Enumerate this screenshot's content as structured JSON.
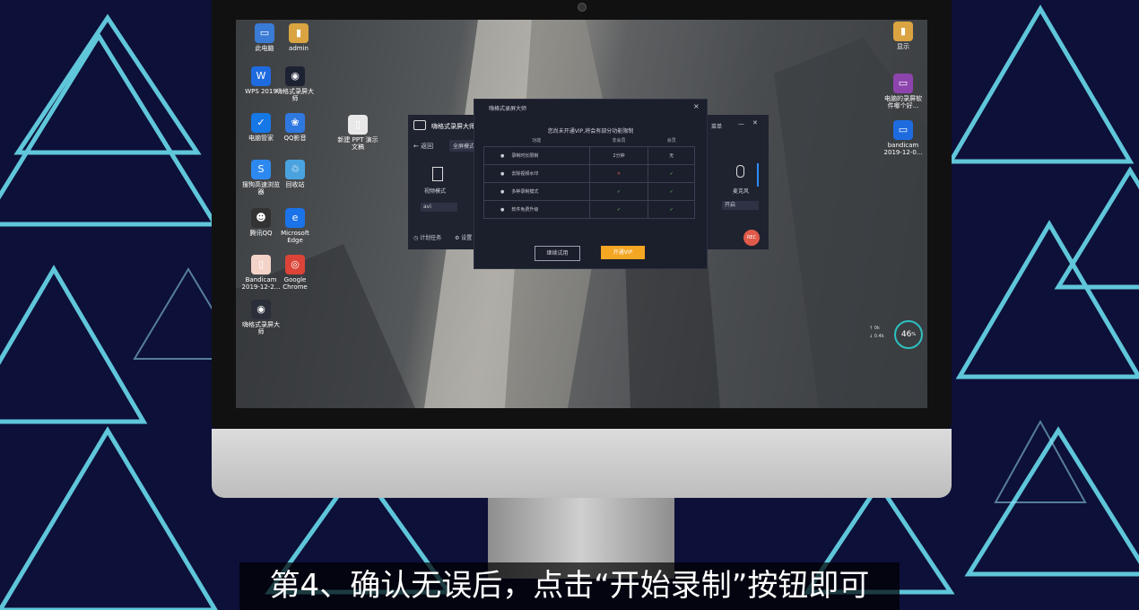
{
  "desktop_icons": [
    {
      "label": "此电脑",
      "color": "#3a7bd5",
      "glyph": "▭"
    },
    {
      "label": "admin",
      "color": "#d9a441",
      "glyph": "▮"
    },
    {
      "label": "WPS 2019",
      "color": "#1e6be0",
      "glyph": "W"
    },
    {
      "label": "嗨格式录屏大师",
      "color": "#1d2233",
      "glyph": "◉"
    },
    {
      "label": "电脑管家",
      "color": "#1677e6",
      "glyph": "✓"
    },
    {
      "label": "QQ影音",
      "color": "#2f78e0",
      "glyph": "❀"
    },
    {
      "label": "新建 PPT 演示文稿",
      "color": "#e8e8e8",
      "glyph": "▯"
    },
    {
      "label": "搜狗高速浏览器",
      "color": "#2d89ef",
      "glyph": "S"
    },
    {
      "label": "回收站",
      "color": "#4aa3df",
      "glyph": "♲"
    },
    {
      "label": "腾讯QQ",
      "color": "#333333",
      "glyph": "☻"
    },
    {
      "label": "Microsoft Edge",
      "color": "#1a73e8",
      "glyph": "e"
    },
    {
      "label": "Bandicam 2019-12-2...",
      "color": "#f3d2c8",
      "glyph": "▯"
    },
    {
      "label": "Google Chrome",
      "color": "#db4437",
      "glyph": "◎"
    },
    {
      "label": "嗨格式录屏大师",
      "color": "#2b2f3a",
      "glyph": "◉"
    },
    {
      "label": "显示",
      "color": "#d9a441",
      "glyph": "▮"
    },
    {
      "label": "电脑的录屏软件哪个好...",
      "color": "#8e44ad",
      "glyph": "▭"
    },
    {
      "label": "bandicam 2019-12-0...",
      "color": "#1e6be0",
      "glyph": "▭"
    }
  ],
  "app": {
    "title": "嗨格式录屏大师",
    "back": "返回",
    "mode": "全屏模式",
    "video_mode": "视频模式",
    "format": "avi",
    "menu": "菜单",
    "mic": "麦克风",
    "mic_state": "开启",
    "schedule": "计划任务",
    "settings": "设置",
    "rec_badge": "REC"
  },
  "dialog": {
    "title": "嗨格式录屏大师",
    "close": "×",
    "headline": "您尚未开通VIP,将会有部分功能限制",
    "columns": [
      "功能",
      "非会员",
      "会员"
    ],
    "rows": [
      {
        "icon": "clock-icon",
        "feature": "录制时长限制",
        "free": "2分钟",
        "vip": "无"
      },
      {
        "icon": "watermark-icon",
        "feature": "去除视频水印",
        "free": "✕",
        "vip": "✓"
      },
      {
        "icon": "modes-icon",
        "feature": "多种录制模式",
        "free": "✓",
        "vip": "✓"
      },
      {
        "icon": "upgrade-icon",
        "feature": "软件免费升级",
        "free": "✓",
        "vip": "✓"
      }
    ],
    "trial_button": "继续试用",
    "vip_button": "开通VIP"
  },
  "widget": {
    "percent": "46",
    "speed_up": "0k",
    "speed_down": "0.4k"
  },
  "subtitle": "第4、确认无误后，点击“开始录制”按钮即可"
}
